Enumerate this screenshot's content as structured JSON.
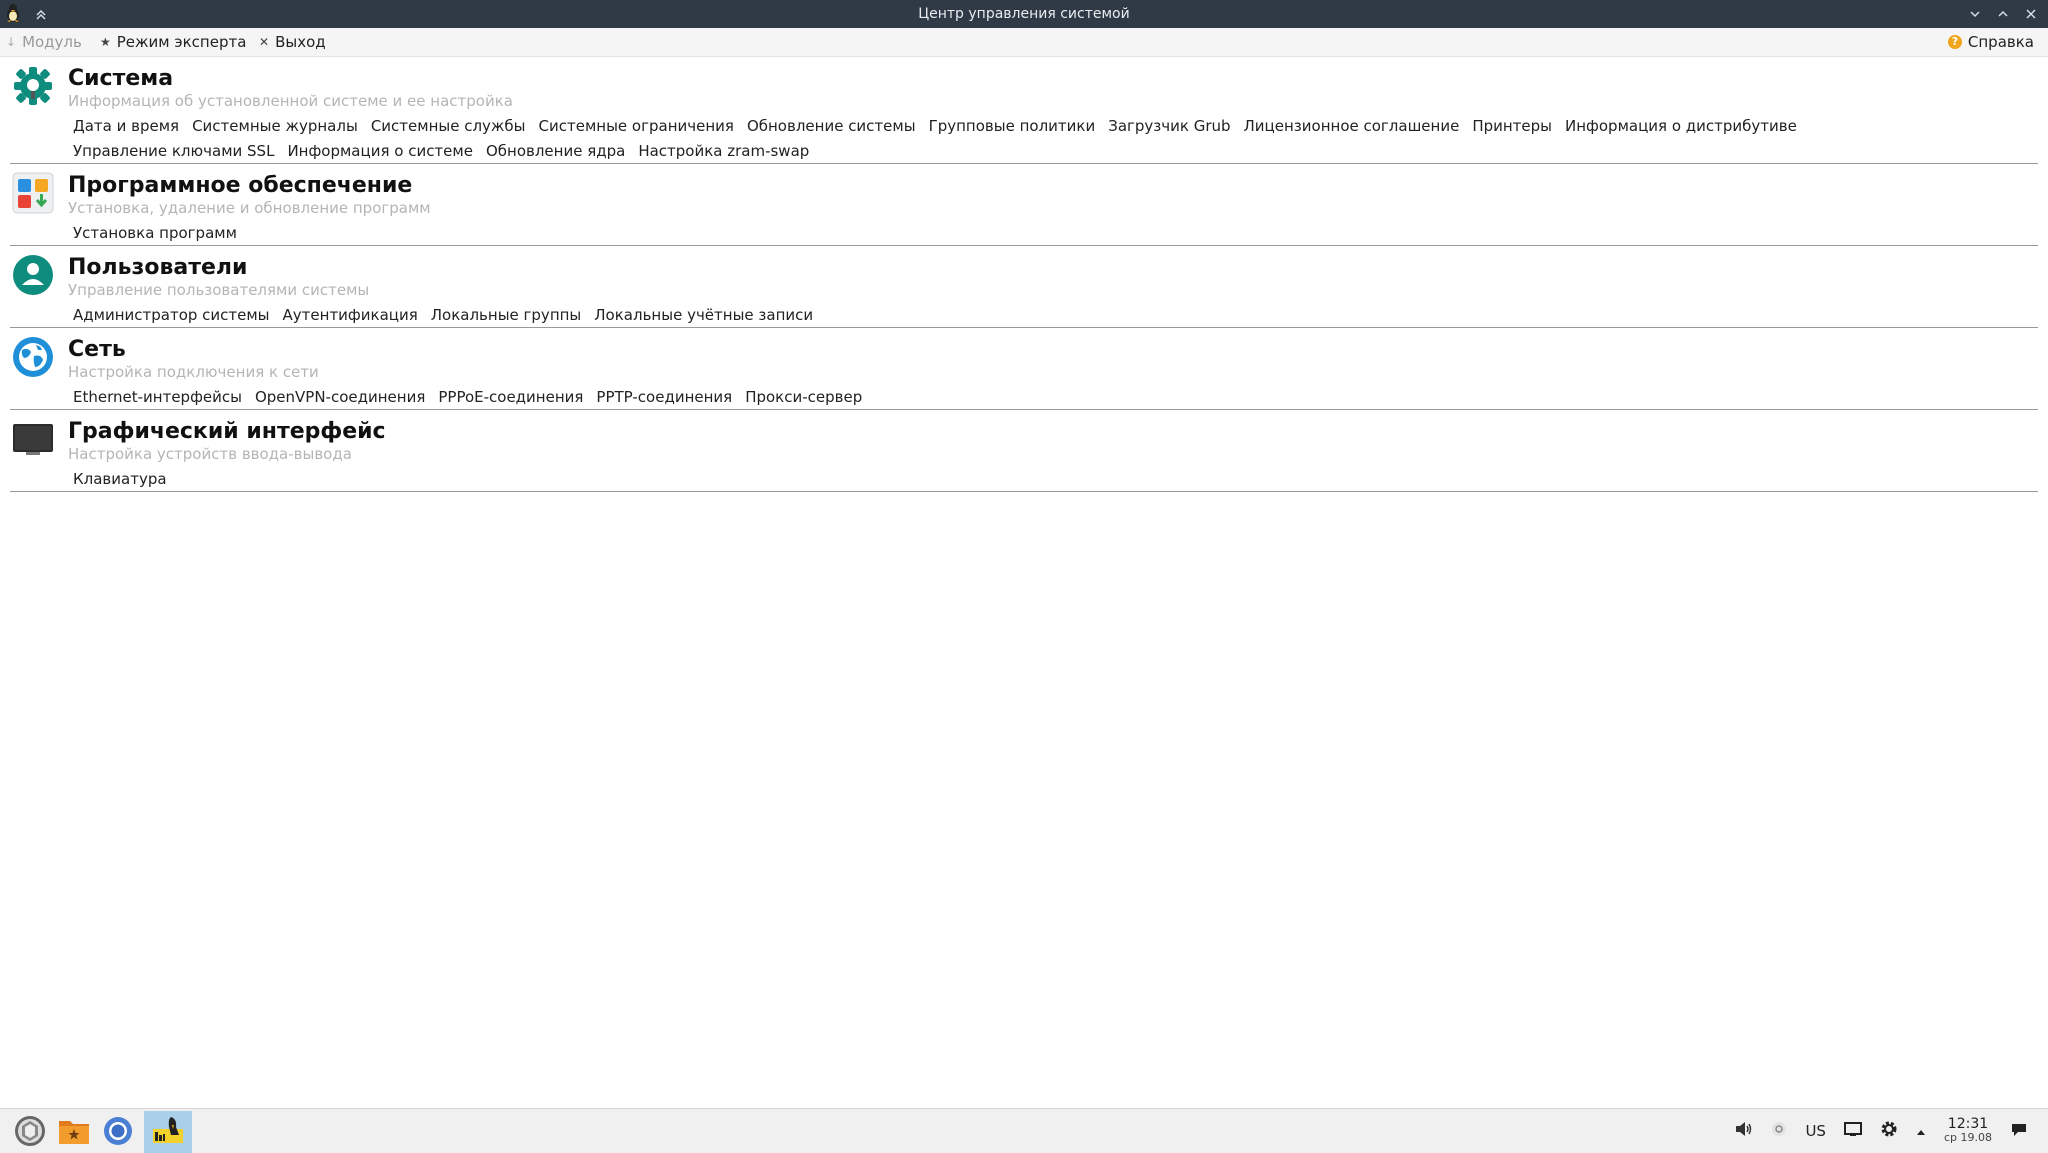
{
  "window": {
    "title": "Центр управления системой"
  },
  "menubar": {
    "module_label": "Модуль",
    "expert_label": "Режим эксперта",
    "exit_label": "Выход",
    "help_label": "Справка"
  },
  "categories": [
    {
      "title": "Система",
      "description": "Информация об установленной системе и ее настройка",
      "icon": "gear-icon",
      "links": [
        "Дата и время",
        "Системные журналы",
        "Системные службы",
        "Системные ограничения",
        "Обновление системы",
        "Групповые политики",
        "Загрузчик Grub",
        "Лицензионное соглашение",
        "Принтеры",
        "Информация о дистрибутиве",
        "Управление ключами SSL",
        "Информация о системе",
        "Обновление ядра",
        "Настройка zram-swap"
      ]
    },
    {
      "title": "Программное обеспечение",
      "description": "Установка, удаление и обновление программ",
      "icon": "software-icon",
      "links": [
        "Установка программ"
      ]
    },
    {
      "title": "Пользователи",
      "description": "Управление пользователями системы",
      "icon": "user-icon",
      "links": [
        "Администратор системы",
        "Аутентификация",
        "Локальные группы",
        "Локальные учётные записи"
      ]
    },
    {
      "title": "Сеть",
      "description": "Настройка подключения к сети",
      "icon": "globe-icon",
      "links": [
        "Ethernet-интерфейсы",
        "OpenVPN-соединения",
        "PPPoE-соединения",
        "PPTP-соединения",
        "Прокси-сервер"
      ]
    },
    {
      "title": "Графический интерфейс",
      "description": "Настройка устройств ввода-вывода",
      "icon": "monitor-icon",
      "links": [
        "Клавиатура"
      ]
    }
  ],
  "taskbar": {
    "keyboard_layout": "US",
    "time": "12:31",
    "date": "ср 19.08"
  },
  "colors": {
    "titlebar": "#2f3a46",
    "accent_teal": "#0e8c7d",
    "globe_blue": "#1f8fd8",
    "taskbar_active": "#a9cfe9"
  }
}
